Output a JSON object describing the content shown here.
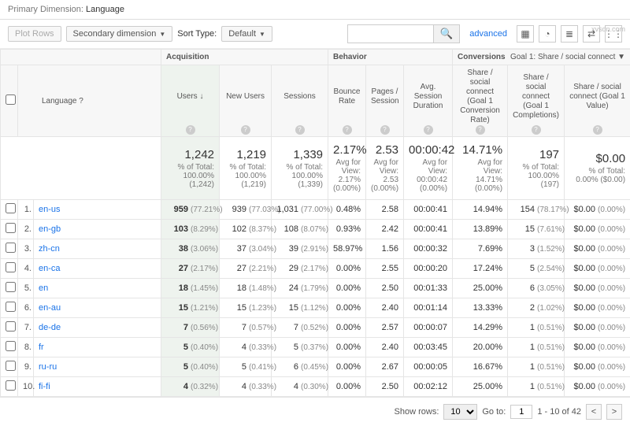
{
  "topbar": {
    "label": "Primary Dimension:",
    "value": "Language"
  },
  "toolbar": {
    "plot_rows": "Plot Rows",
    "secondary": "Secondary dimension",
    "sorttype_lbl": "Sort Type:",
    "sorttype_val": "Default",
    "advanced": "advanced",
    "search_placeholder": ""
  },
  "groups": {
    "acq": "Acquisition",
    "beh": "Behavior",
    "conv": "Conversions",
    "conv_select": "Goal 1: Share / social connect"
  },
  "headers": {
    "language": "Language",
    "users": "Users",
    "newusers": "New Users",
    "sessions": "Sessions",
    "bounce": "Bounce Rate",
    "pps": "Pages / Session",
    "dur": "Avg. Session Duration",
    "rate": "Share / social connect (Goal 1 Conversion Rate)",
    "comp": "Share / social connect (Goal 1 Completions)",
    "value": "Share / social connect (Goal 1 Value)"
  },
  "totals": {
    "users": {
      "big": "1,242",
      "sub": "% of Total: 100.00% (1,242)"
    },
    "newusers": {
      "big": "1,219",
      "sub": "% of Total: 100.00% (1,219)"
    },
    "sessions": {
      "big": "1,339",
      "sub": "% of Total: 100.00% (1,339)"
    },
    "bounce": {
      "big": "2.17%",
      "sub": "Avg for View: 2.17% (0.00%)"
    },
    "pps": {
      "big": "2.53",
      "sub": "Avg for View: 2.53 (0.00%)"
    },
    "dur": {
      "big": "00:00:42",
      "sub": "Avg for View: 00:00:42 (0.00%)"
    },
    "rate": {
      "big": "14.71%",
      "sub": "Avg for View: 14.71% (0.00%)"
    },
    "comp": {
      "big": "197",
      "sub": "% of Total: 100.00% (197)"
    },
    "value": {
      "big": "$0.00",
      "sub": "% of Total: 0.00% ($0.00)"
    }
  },
  "rows": [
    {
      "n": "1.",
      "lang": "en-us",
      "u": "959",
      "up": "(77.21%)",
      "nu": "939",
      "nup": "(77.03%)",
      "s": "1,031",
      "sp": "(77.00%)",
      "b": "0.48%",
      "p": "2.58",
      "d": "00:00:41",
      "r": "14.94%",
      "c": "154",
      "cp": "(78.17%)",
      "v": "$0.00",
      "vp": "(0.00%)"
    },
    {
      "n": "2.",
      "lang": "en-gb",
      "u": "103",
      "up": "(8.29%)",
      "nu": "102",
      "nup": "(8.37%)",
      "s": "108",
      "sp": "(8.07%)",
      "b": "0.93%",
      "p": "2.42",
      "d": "00:00:41",
      "r": "13.89%",
      "c": "15",
      "cp": "(7.61%)",
      "v": "$0.00",
      "vp": "(0.00%)"
    },
    {
      "n": "3.",
      "lang": "zh-cn",
      "u": "38",
      "up": "(3.06%)",
      "nu": "37",
      "nup": "(3.04%)",
      "s": "39",
      "sp": "(2.91%)",
      "b": "58.97%",
      "p": "1.56",
      "d": "00:00:32",
      "r": "7.69%",
      "c": "3",
      "cp": "(1.52%)",
      "v": "$0.00",
      "vp": "(0.00%)"
    },
    {
      "n": "4.",
      "lang": "en-ca",
      "u": "27",
      "up": "(2.17%)",
      "nu": "27",
      "nup": "(2.21%)",
      "s": "29",
      "sp": "(2.17%)",
      "b": "0.00%",
      "p": "2.55",
      "d": "00:00:20",
      "r": "17.24%",
      "c": "5",
      "cp": "(2.54%)",
      "v": "$0.00",
      "vp": "(0.00%)"
    },
    {
      "n": "5.",
      "lang": "en",
      "u": "18",
      "up": "(1.45%)",
      "nu": "18",
      "nup": "(1.48%)",
      "s": "24",
      "sp": "(1.79%)",
      "b": "0.00%",
      "p": "2.50",
      "d": "00:01:33",
      "r": "25.00%",
      "c": "6",
      "cp": "(3.05%)",
      "v": "$0.00",
      "vp": "(0.00%)"
    },
    {
      "n": "6.",
      "lang": "en-au",
      "u": "15",
      "up": "(1.21%)",
      "nu": "15",
      "nup": "(1.23%)",
      "s": "15",
      "sp": "(1.12%)",
      "b": "0.00%",
      "p": "2.40",
      "d": "00:01:14",
      "r": "13.33%",
      "c": "2",
      "cp": "(1.02%)",
      "v": "$0.00",
      "vp": "(0.00%)"
    },
    {
      "n": "7.",
      "lang": "de-de",
      "u": "7",
      "up": "(0.56%)",
      "nu": "7",
      "nup": "(0.57%)",
      "s": "7",
      "sp": "(0.52%)",
      "b": "0.00%",
      "p": "2.57",
      "d": "00:00:07",
      "r": "14.29%",
      "c": "1",
      "cp": "(0.51%)",
      "v": "$0.00",
      "vp": "(0.00%)"
    },
    {
      "n": "8.",
      "lang": "fr",
      "u": "5",
      "up": "(0.40%)",
      "nu": "4",
      "nup": "(0.33%)",
      "s": "5",
      "sp": "(0.37%)",
      "b": "0.00%",
      "p": "2.40",
      "d": "00:03:45",
      "r": "20.00%",
      "c": "1",
      "cp": "(0.51%)",
      "v": "$0.00",
      "vp": "(0.00%)"
    },
    {
      "n": "9.",
      "lang": "ru-ru",
      "u": "5",
      "up": "(0.40%)",
      "nu": "5",
      "nup": "(0.41%)",
      "s": "6",
      "sp": "(0.45%)",
      "b": "0.00%",
      "p": "2.67",
      "d": "00:00:05",
      "r": "16.67%",
      "c": "1",
      "cp": "(0.51%)",
      "v": "$0.00",
      "vp": "(0.00%)"
    },
    {
      "n": "10.",
      "lang": "fi-fi",
      "u": "4",
      "up": "(0.32%)",
      "nu": "4",
      "nup": "(0.33%)",
      "s": "4",
      "sp": "(0.30%)",
      "b": "0.00%",
      "p": "2.50",
      "d": "00:02:12",
      "r": "25.00%",
      "c": "1",
      "cp": "(0.51%)",
      "v": "$0.00",
      "vp": "(0.00%)"
    }
  ],
  "pager": {
    "showrows": "Show rows:",
    "rows_val": "10",
    "goto": "Go to:",
    "goto_val": "1",
    "range": "1 - 10 of 42"
  },
  "watermark": "xvsdn.com"
}
